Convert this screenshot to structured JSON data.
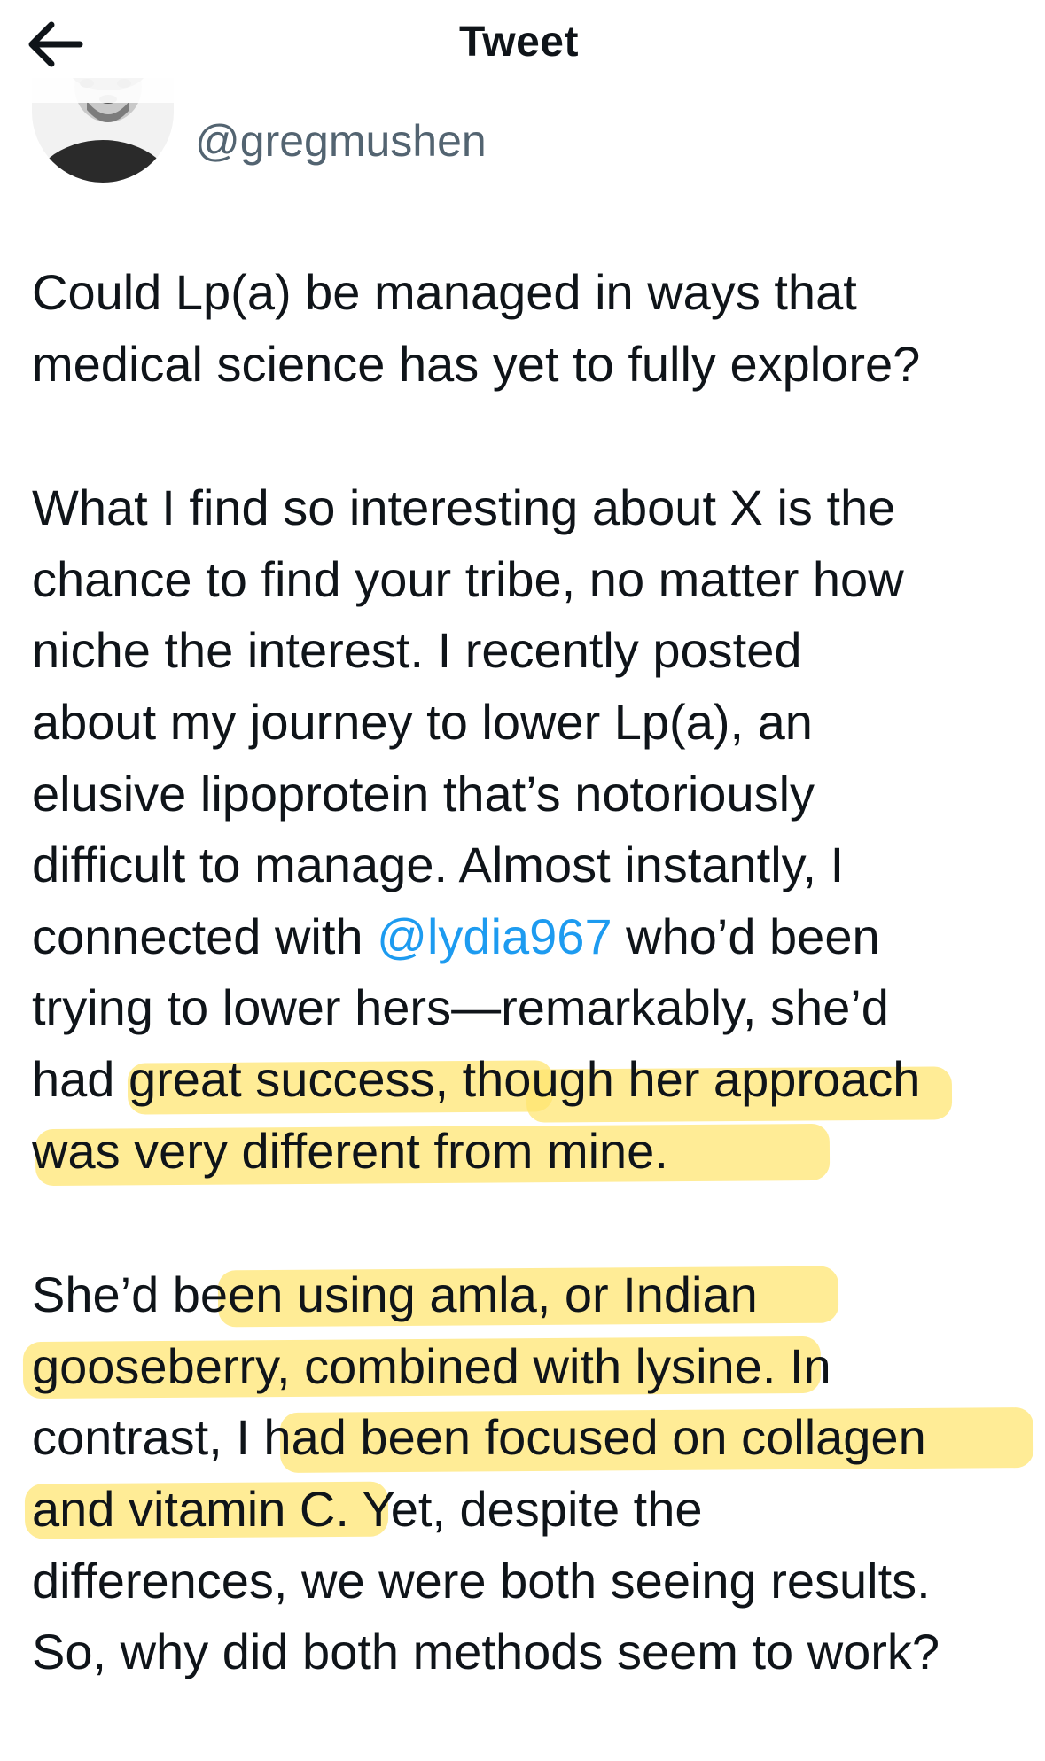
{
  "header": {
    "back_icon": "arrow-left-icon",
    "title": "Tweet"
  },
  "user": {
    "handle": "@gregmushen"
  },
  "tweet": {
    "paragraph1": [
      "Could Lp(a) be managed in ways that",
      "medical science has yet to fully explore?"
    ],
    "paragraph2": {
      "lines_before_mention": [
        "What I find so interesting about X is the",
        "chance to find your tribe, no matter how",
        "niche the interest. I recently posted",
        "about my journey to lower Lp(a), an",
        "elusive lipoprotein that’s notoriously",
        "difficult to manage. Almost instantly, I"
      ],
      "mention_line_prefix": "connected with ",
      "mention": "@lydia967",
      "mention_line_suffix": " who’d been",
      "lines_after_mention": [
        "trying to lower hers—remarkably, she’d",
        "had great success, though her approach",
        "was very different from mine."
      ]
    },
    "paragraph3": [
      "She’d been using amla, or Indian",
      "gooseberry, combined with lysine. In",
      "contrast, I had been focused on collagen",
      "and vitamin C. Yet, despite the",
      "differences, we were both seeing results.",
      "So, why did both methods seem to work?"
    ]
  },
  "colors": {
    "text": "#0f1419",
    "secondary_text": "#536471",
    "link": "#1d9bf0",
    "highlight": "#ffe56d"
  }
}
